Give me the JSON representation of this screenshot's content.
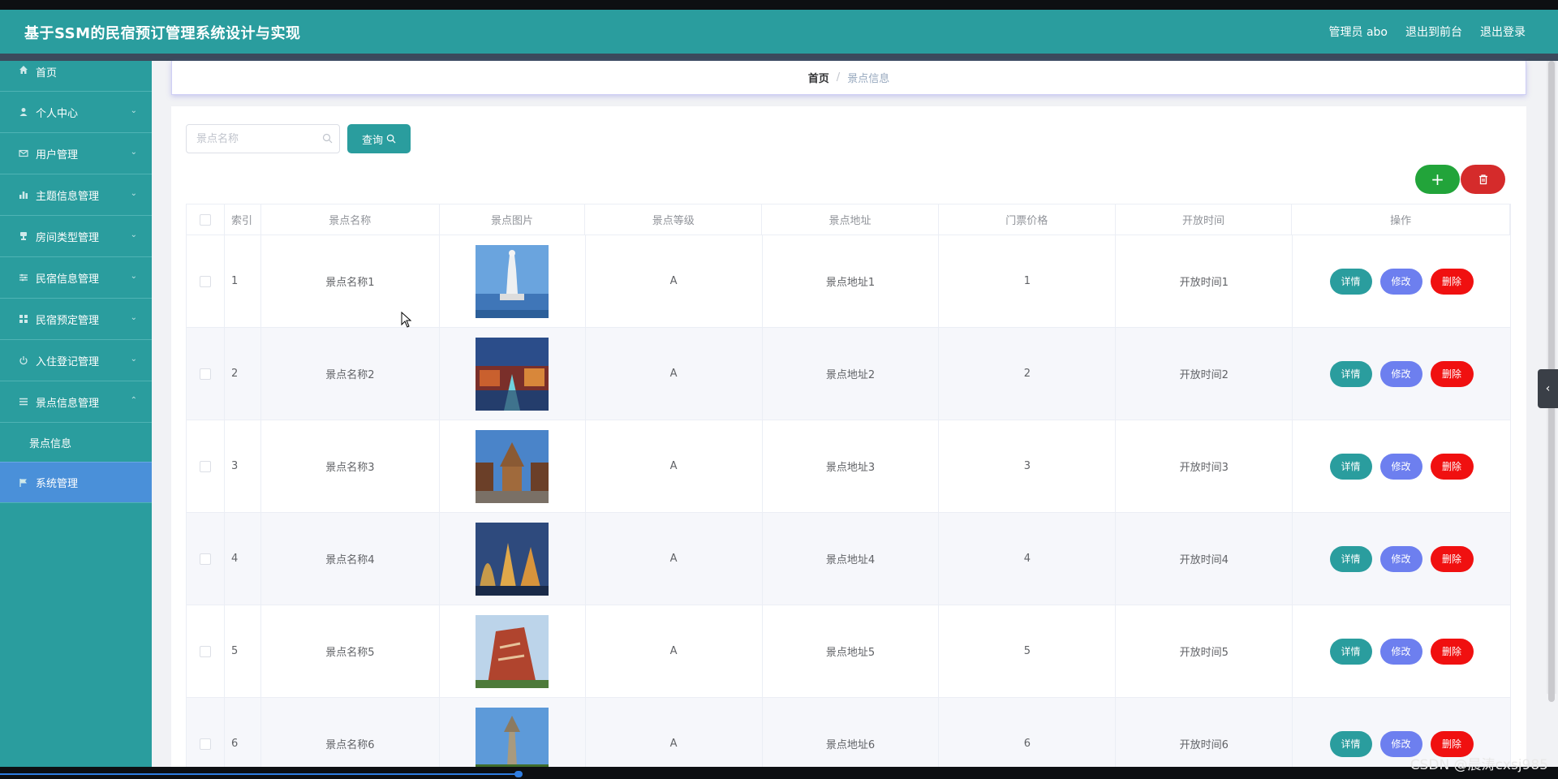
{
  "header": {
    "title": "基于SSM的民宿预订管理系统设计与实现",
    "admin": "管理员 abo",
    "exit_front": "退出到前台",
    "logout": "退出登录"
  },
  "sidebar": {
    "items": [
      {
        "label": "首页",
        "icon": "home-icon"
      },
      {
        "label": "个人中心",
        "icon": "user-icon"
      },
      {
        "label": "用户管理",
        "icon": "mail-icon"
      },
      {
        "label": "主题信息管理",
        "icon": "bar-chart-icon"
      },
      {
        "label": "房间类型管理",
        "icon": "stamp-icon"
      },
      {
        "label": "民宿信息管理",
        "icon": "sliders-icon"
      },
      {
        "label": "民宿预定管理",
        "icon": "grid-icon"
      },
      {
        "label": "入住登记管理",
        "icon": "power-icon"
      },
      {
        "label": "景点信息管理",
        "icon": "list-icon"
      }
    ],
    "sub_item": "景点信息",
    "active_item": "系统管理",
    "active_color": "#4a90d9"
  },
  "breadcrumb": {
    "home": "首页",
    "separator": "/",
    "current": "景点信息"
  },
  "search": {
    "placeholder": "景点名称",
    "query_label": "查询"
  },
  "table": {
    "headers": [
      "索引",
      "景点名称",
      "景点图片",
      "景点等级",
      "景点地址",
      "门票价格",
      "开放时间",
      "操作"
    ],
    "rows": [
      {
        "idx": "1",
        "name": "景点名称1",
        "level": "A",
        "address": "景点地址1",
        "price": "1",
        "time": "开放时间1"
      },
      {
        "idx": "2",
        "name": "景点名称2",
        "level": "A",
        "address": "景点地址2",
        "price": "2",
        "time": "开放时间2"
      },
      {
        "idx": "3",
        "name": "景点名称3",
        "level": "A",
        "address": "景点地址3",
        "price": "3",
        "time": "开放时间3"
      },
      {
        "idx": "4",
        "name": "景点名称4",
        "level": "A",
        "address": "景点地址4",
        "price": "4",
        "time": "开放时间4"
      },
      {
        "idx": "5",
        "name": "景点名称5",
        "level": "A",
        "address": "景点地址5",
        "price": "5",
        "time": "开放时间5"
      },
      {
        "idx": "6",
        "name": "景点名称6",
        "level": "A",
        "address": "景点地址6",
        "price": "6",
        "time": "开放时间6"
      }
    ],
    "actions": {
      "detail": "详情",
      "edit": "修改",
      "delete": "删除"
    }
  },
  "colors": {
    "primary": "#2a9d9e",
    "add": "#22a43a",
    "delete": "#d52b2b",
    "edit": "#6d7fef",
    "danger": "#f01010"
  },
  "watermark": "CSDN @晨涛cxsj985"
}
